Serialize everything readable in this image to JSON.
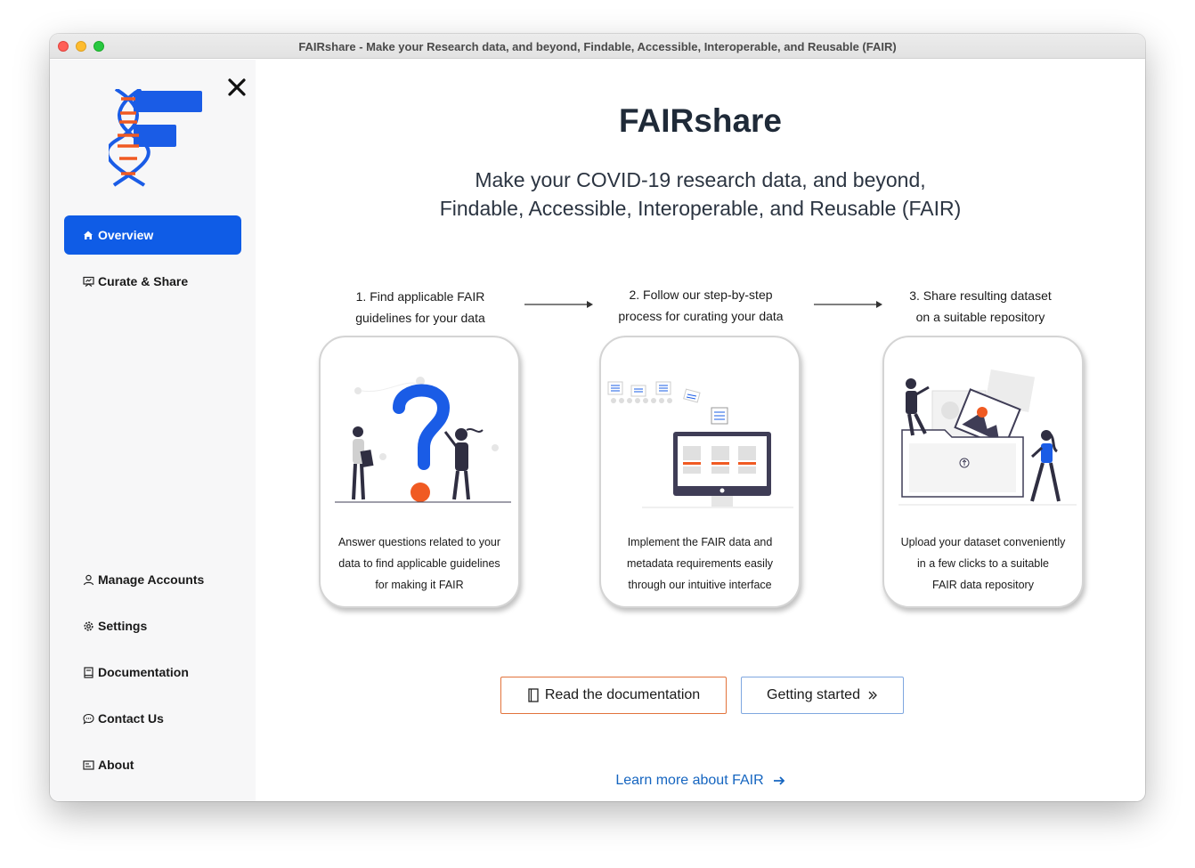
{
  "window": {
    "title": "FAIRshare - Make your Research data, and beyond, Findable, Accessible, Interoperable, and Reusable (FAIR)"
  },
  "sidebar": {
    "close_icon": "close-icon",
    "logo": "fairshare-logo",
    "items": [
      {
        "label": "Overview",
        "icon": "home-icon",
        "active": true
      },
      {
        "label": "Curate & Share",
        "icon": "curate-icon",
        "active": false
      },
      {
        "label": "Manage Accounts",
        "icon": "user-icon",
        "active": false
      },
      {
        "label": "Settings",
        "icon": "gear-icon",
        "active": false
      },
      {
        "label": "Documentation",
        "icon": "book-icon",
        "active": false
      },
      {
        "label": "Contact Us",
        "icon": "chat-icon",
        "active": false
      },
      {
        "label": "About",
        "icon": "info-card-icon",
        "active": false
      }
    ]
  },
  "main": {
    "title": "FAIRshare",
    "subtitle_line1": "Make your COVID-19 research data, and beyond,",
    "subtitle_line2": "Findable, Accessible, Interoperable, and Reusable (FAIR)",
    "steps": [
      {
        "label_line1": "1. Find applicable FAIR",
        "label_line2": "guidelines for your data",
        "desc_line1": "Answer questions related to your",
        "desc_line2": "data to find applicable guidelines",
        "desc_line3": "for making it FAIR"
      },
      {
        "label_line1": "2. Follow our step-by-step",
        "label_line2": "process for curating your data",
        "desc_line1": "Implement the FAIR data and",
        "desc_line2": "metadata requirements easily",
        "desc_line3": "through our intuitive interface"
      },
      {
        "label_line1": "3. Share resulting dataset",
        "label_line2": "on a suitable repository",
        "desc_line1": "Upload your dataset conveniently",
        "desc_line2": "in a few clicks to a suitable",
        "desc_line3": "FAIR data repository"
      }
    ],
    "buttons": {
      "read_docs": "Read the documentation",
      "getting_started": "Getting started"
    },
    "learn_more": "Learn more about FAIR"
  },
  "colors": {
    "accent_blue": "#0f5ce6",
    "illustration_orange": "#f05a22",
    "doc_button_border": "#e2733c",
    "start_button_border": "#7fa7e0",
    "link_blue": "#1565c0"
  }
}
